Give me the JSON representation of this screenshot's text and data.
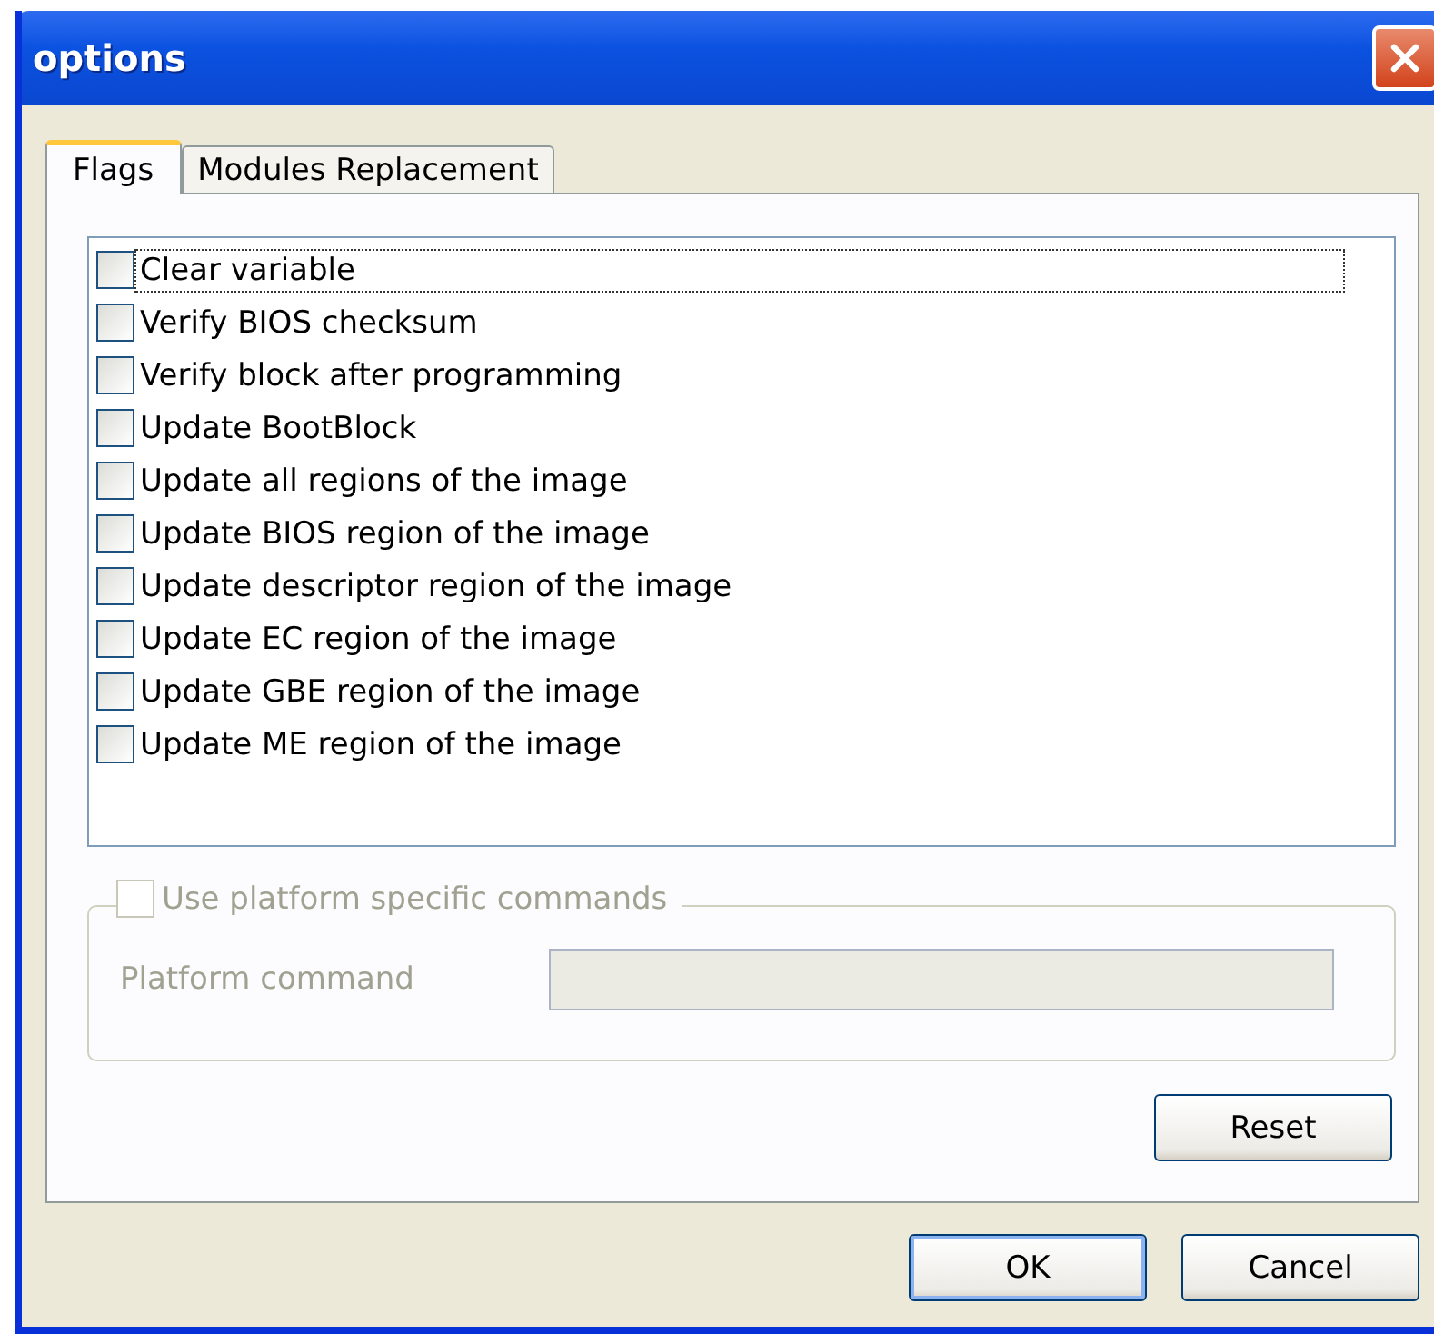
{
  "window": {
    "title": "options"
  },
  "tabs": [
    {
      "label": "Flags",
      "selected": true
    },
    {
      "label": "Modules Replacement",
      "selected": false
    }
  ],
  "flags": [
    {
      "label": "Clear variable",
      "checked": false,
      "focused": true
    },
    {
      "label": "Verify BIOS checksum",
      "checked": false,
      "focused": false
    },
    {
      "label": "Verify block after programming",
      "checked": false,
      "focused": false
    },
    {
      "label": "Update BootBlock",
      "checked": false,
      "focused": false
    },
    {
      "label": "Update all regions of the image",
      "checked": false,
      "focused": false
    },
    {
      "label": "Update BIOS region of the image",
      "checked": false,
      "focused": false
    },
    {
      "label": "Update descriptor region of the image",
      "checked": false,
      "focused": false
    },
    {
      "label": "Update EC region of the image",
      "checked": false,
      "focused": false
    },
    {
      "label": "Update GBE region of the image",
      "checked": false,
      "focused": false
    },
    {
      "label": "Update ME region of the image",
      "checked": false,
      "focused": false
    }
  ],
  "platform": {
    "label": "Use platform specific commands",
    "checked": false,
    "disabled": true,
    "field_label": "Platform command"
  },
  "reset_button": "Reset",
  "buttons": [
    {
      "label": "OK",
      "default": true
    },
    {
      "label": "Cancel",
      "default": false
    }
  ]
}
